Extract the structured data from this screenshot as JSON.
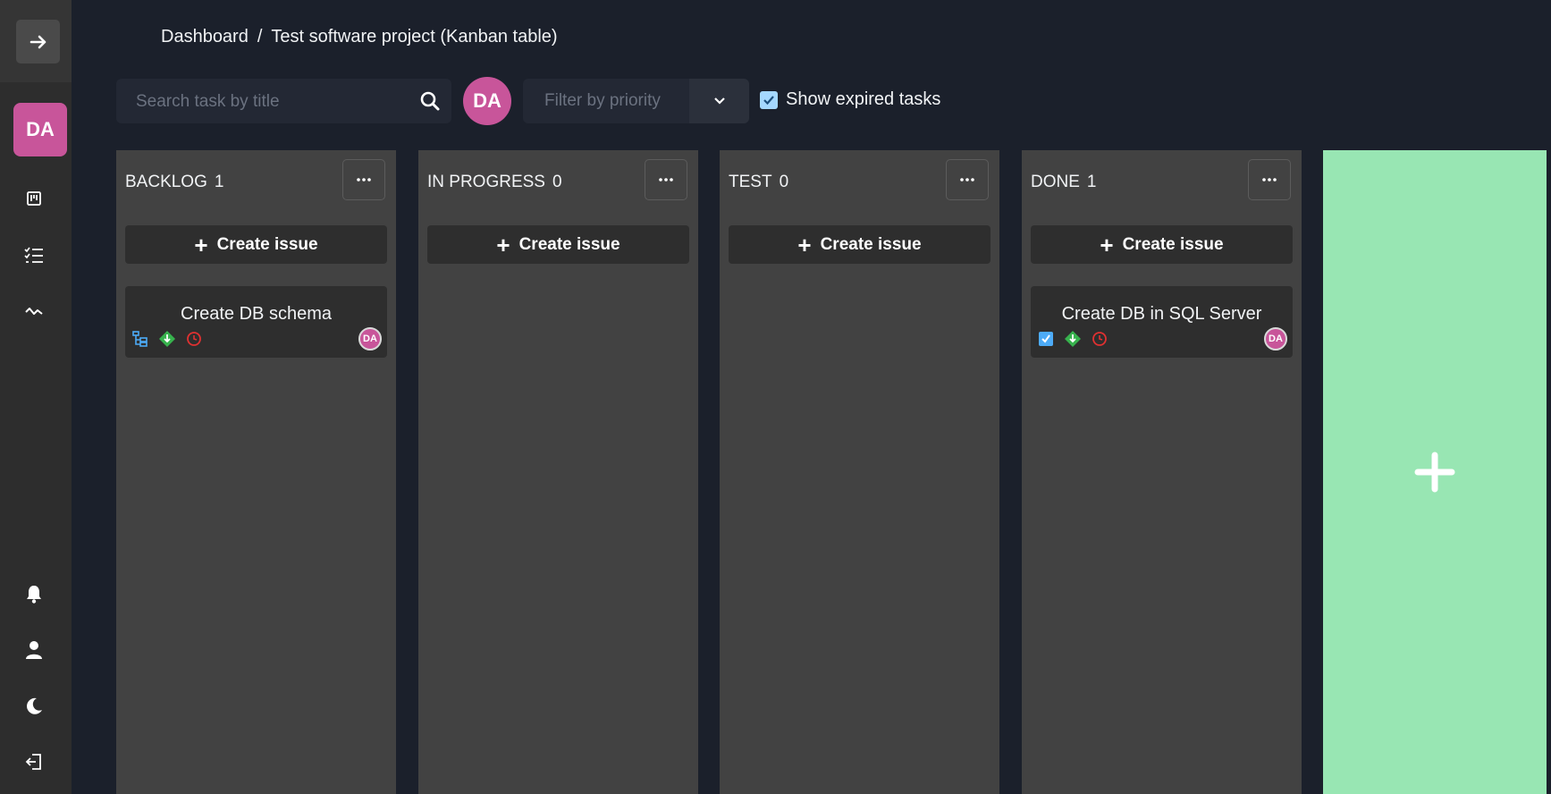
{
  "breadcrumb": {
    "root": "Dashboard",
    "separator": "/",
    "current": "Test software project (Kanban table)"
  },
  "sidebar": {
    "user_initials": "DA",
    "top_icons": [
      "arrow-right-icon",
      "board-icon",
      "task-list-icon",
      "activity-icon"
    ],
    "bottom_icons": [
      "bell-icon",
      "user-icon",
      "moon-icon",
      "logout-icon"
    ]
  },
  "toolbar": {
    "search_placeholder": "Search task by title",
    "user_initials": "DA",
    "filter_placeholder": "Filter by priority",
    "show_expired_label": "Show expired tasks",
    "show_expired_checked": true
  },
  "columns": [
    {
      "title": "BACKLOG",
      "count": "1",
      "create_label": "Create issue",
      "menu_label": "···",
      "card": {
        "title": "Create DB schema",
        "type_icon": "subtask-icon",
        "assignee": "DA"
      }
    },
    {
      "title": "IN PROGRESS",
      "count": "0",
      "create_label": "Create issue",
      "menu_label": "···"
    },
    {
      "title": "TEST",
      "count": "0",
      "create_label": "Create issue",
      "menu_label": "···"
    },
    {
      "title": "DONE",
      "count": "1",
      "create_label": "Create issue",
      "menu_label": "···",
      "card": {
        "title": "Create DB in SQL Server",
        "type_icon": "task-checkbox-icon",
        "assignee": "DA"
      }
    }
  ],
  "add_column": {
    "icon": "plus-icon"
  },
  "colors": {
    "accent": "#c8559a",
    "add_column": "#98e6b3",
    "column_bg": "#424242",
    "page_bg": "#1b202b"
  }
}
